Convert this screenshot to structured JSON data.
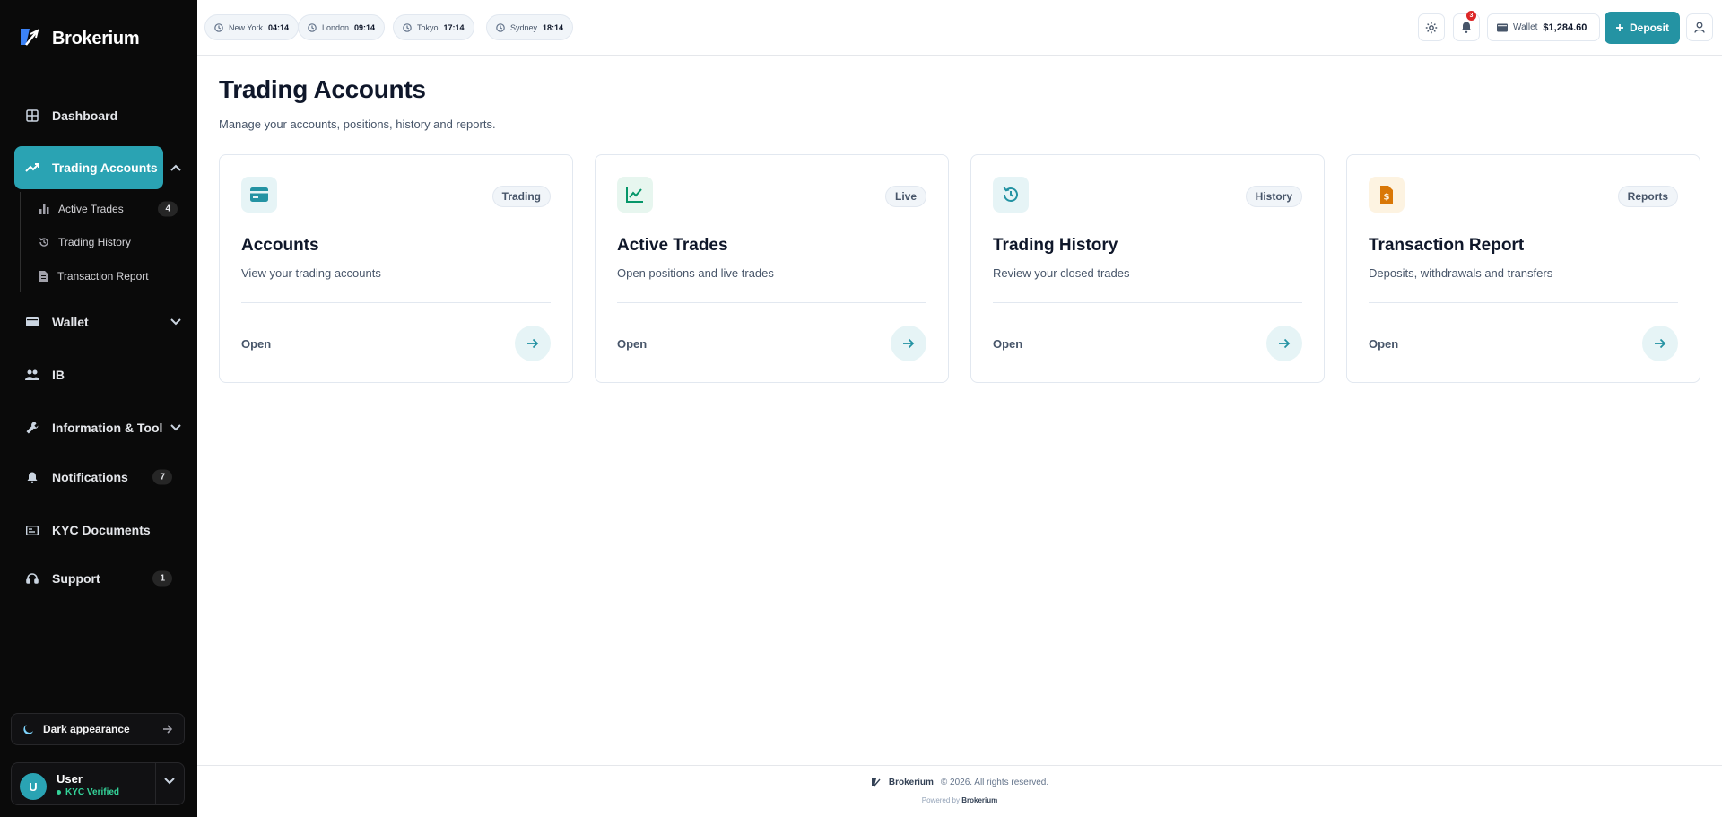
{
  "brand": {
    "name": "Brokerium"
  },
  "sidebar": {
    "items": [
      {
        "label": "Dashboard",
        "icon": "grid-icon"
      },
      {
        "label": "Trading Accounts",
        "icon": "trending-up-icon",
        "active": true
      },
      {
        "label": "Wallet",
        "icon": "wallet-icon"
      },
      {
        "label": "IB",
        "icon": "users-icon"
      },
      {
        "label": "Information & Tool",
        "icon": "wrench-icon"
      },
      {
        "label": "Notifications",
        "icon": "bell-icon",
        "badge": "7"
      },
      {
        "label": "KYC Documents",
        "icon": "id-card-icon"
      },
      {
        "label": "Support",
        "icon": "headset-icon",
        "badge": "1"
      }
    ],
    "subitems": [
      {
        "label": "Active Trades",
        "icon": "bar-chart-icon",
        "badge": "4"
      },
      {
        "label": "Trading History",
        "icon": "history-icon"
      },
      {
        "label": "Transaction Report",
        "icon": "file-icon"
      }
    ],
    "dark_toggle": {
      "label": "Dark appearance",
      "icon": "moon-icon"
    },
    "user": {
      "initial": "U",
      "name": "User",
      "status": "KYC Verified"
    }
  },
  "topbar": {
    "clocks": [
      {
        "city": "New York",
        "time": "04:14"
      },
      {
        "city": "London",
        "time": "09:14"
      },
      {
        "city": "Tokyo",
        "time": "17:14"
      },
      {
        "city": "Sydney",
        "time": "18:14"
      }
    ],
    "notifications_count": "3",
    "wallet_label": "Wallet",
    "wallet_amount": "$1,284.60",
    "deposit_label": "Deposit"
  },
  "main": {
    "title": "Trading Accounts",
    "subtitle": "Manage your accounts, positions, history and reports.",
    "cards": [
      {
        "title": "Accounts",
        "tag": "Trading",
        "desc": "View your trading accounts",
        "open": "Open",
        "icon": "credit-card-icon",
        "icon_color": "#2493a3",
        "icon_bg": "#e6f4f6"
      },
      {
        "title": "Active Trades",
        "tag": "Live",
        "desc": "Open positions and live trades",
        "open": "Open",
        "icon": "line-chart-icon",
        "icon_color": "#059669",
        "icon_bg": "#e7f6ef"
      },
      {
        "title": "Trading History",
        "tag": "History",
        "desc": "Review your closed trades",
        "open": "Open",
        "icon": "history-icon",
        "icon_color": "#2493a3",
        "icon_bg": "#e6f4f6"
      },
      {
        "title": "Transaction Report",
        "tag": "Reports",
        "desc": "Deposits, withdrawals and transfers",
        "open": "Open",
        "icon": "file-dollar-icon",
        "icon_color": "#d97706",
        "icon_bg": "#fdf3e1"
      }
    ]
  },
  "footer": {
    "brand": "Brokerium",
    "copyright": "© 2026. All rights reserved.",
    "powered_prefix": "Powered by",
    "powered_brand": "Brokerium"
  },
  "colors": {
    "accent": "#2aa3b3",
    "sidebar_bg": "#0a0a0a",
    "verified": "#34d399",
    "alert": "#dc2626"
  }
}
